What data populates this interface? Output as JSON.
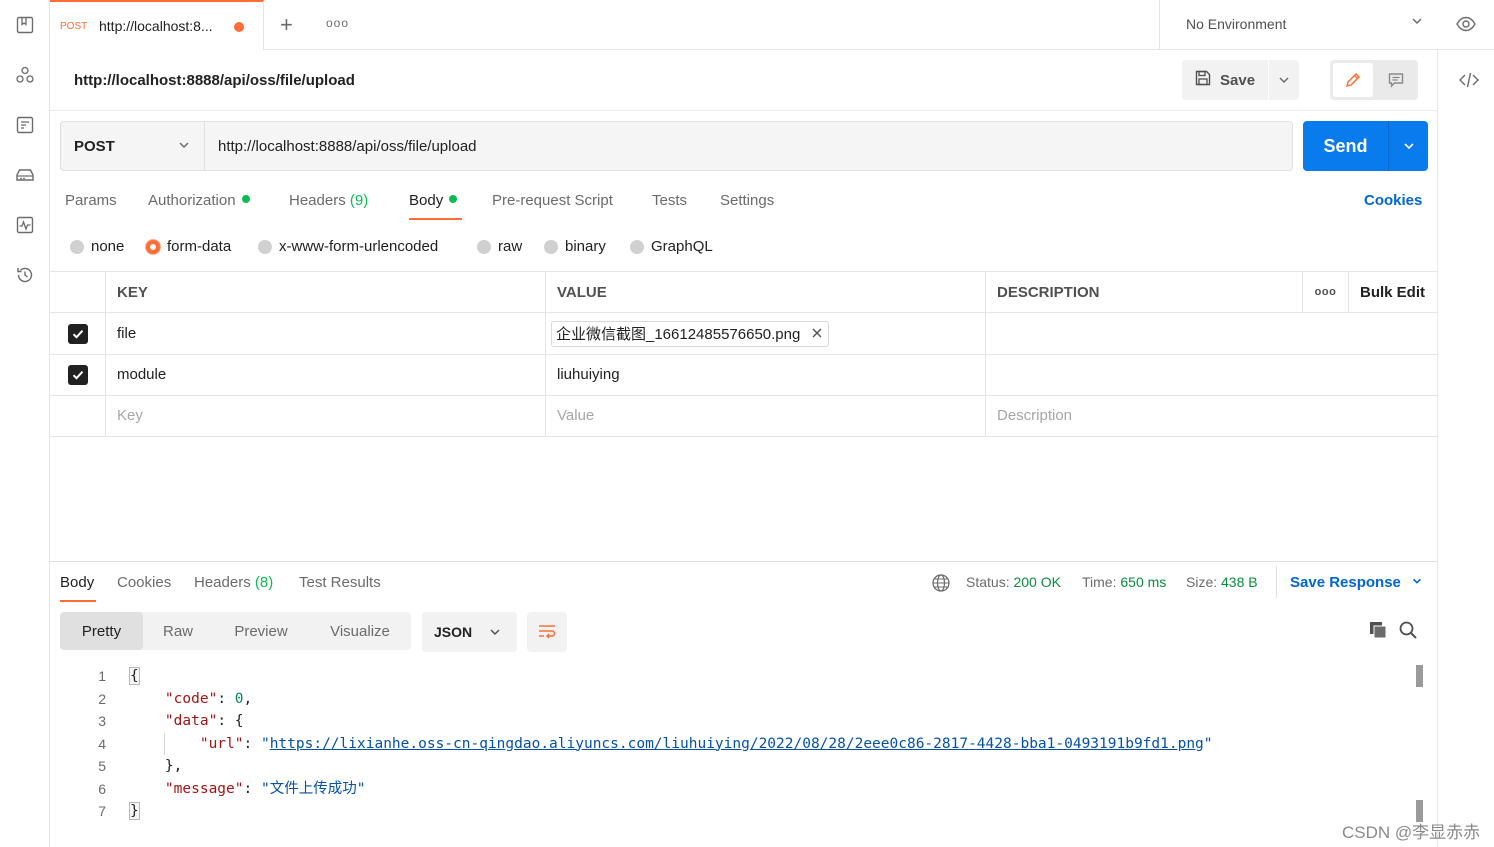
{
  "tab": {
    "method": "POST",
    "title": "http://localhost:8..."
  },
  "environment": {
    "label": "No Environment"
  },
  "request": {
    "name": "http://localhost:8888/api/oss/file/upload",
    "save_label": "Save",
    "method": "POST",
    "url": "http://localhost:8888/api/oss/file/upload",
    "send_label": "Send"
  },
  "request_tabs": {
    "params": "Params",
    "authorization": "Authorization",
    "headers": "Headers",
    "headers_count": "(9)",
    "body": "Body",
    "pre_request": "Pre-request Script",
    "tests": "Tests",
    "settings": "Settings",
    "cookies": "Cookies"
  },
  "body_types": {
    "none": "none",
    "form_data": "form-data",
    "urlencoded": "x-www-form-urlencoded",
    "raw": "raw",
    "binary": "binary",
    "graphql": "GraphQL",
    "selected": "form-data"
  },
  "form_table": {
    "headers": {
      "key": "KEY",
      "value": "VALUE",
      "description": "DESCRIPTION",
      "bulk_edit": "Bulk Edit"
    },
    "rows": [
      {
        "key": "file",
        "value": "企业微信截图_16612485576650.png",
        "checked": true
      },
      {
        "key": "module",
        "value": "liuhuiying",
        "checked": true
      }
    ],
    "placeholders": {
      "key": "Key",
      "value": "Value",
      "description": "Description"
    }
  },
  "response_tabs": {
    "body": "Body",
    "cookies": "Cookies",
    "headers": "Headers",
    "headers_count": "(8)",
    "test_results": "Test Results"
  },
  "response_status": {
    "status_label": "Status:",
    "status": "200 OK",
    "time_label": "Time:",
    "time": "650 ms",
    "size_label": "Size:",
    "size": "438 B",
    "save_response": "Save Response"
  },
  "view_modes": {
    "pretty": "Pretty",
    "raw": "Raw",
    "preview": "Preview",
    "visualize": "Visualize",
    "format": "JSON"
  },
  "code": {
    "line_numbers": [
      "1",
      "2",
      "3",
      "4",
      "5",
      "6",
      "7"
    ],
    "open_brace": "{",
    "code_key": "\"code\"",
    "code_value": "0",
    "data_key": "\"data\"",
    "data_open": "{",
    "url_key": "\"url\"",
    "url_value": "https://lixianhe.oss-cn-qingdao.aliyuncs.com/liuhuiying/2022/08/28/2eee0c86-2817-4428-bba1-0493191b9fd1.png",
    "data_close": "},",
    "message_key": "\"message\"",
    "message_value": "\"文件上传成功\"",
    "close_brace": "}"
  },
  "watermark": "CSDN @李显赤赤",
  "icons": {
    "rail": [
      "collections-icon",
      "apis-icon",
      "environments-icon",
      "mock-servers-icon",
      "monitors-icon",
      "history-icon"
    ]
  },
  "colors": {
    "accent": "#ff6c37",
    "primary": "#097bed",
    "link": "#0265d2",
    "success": "#0cbb52"
  }
}
